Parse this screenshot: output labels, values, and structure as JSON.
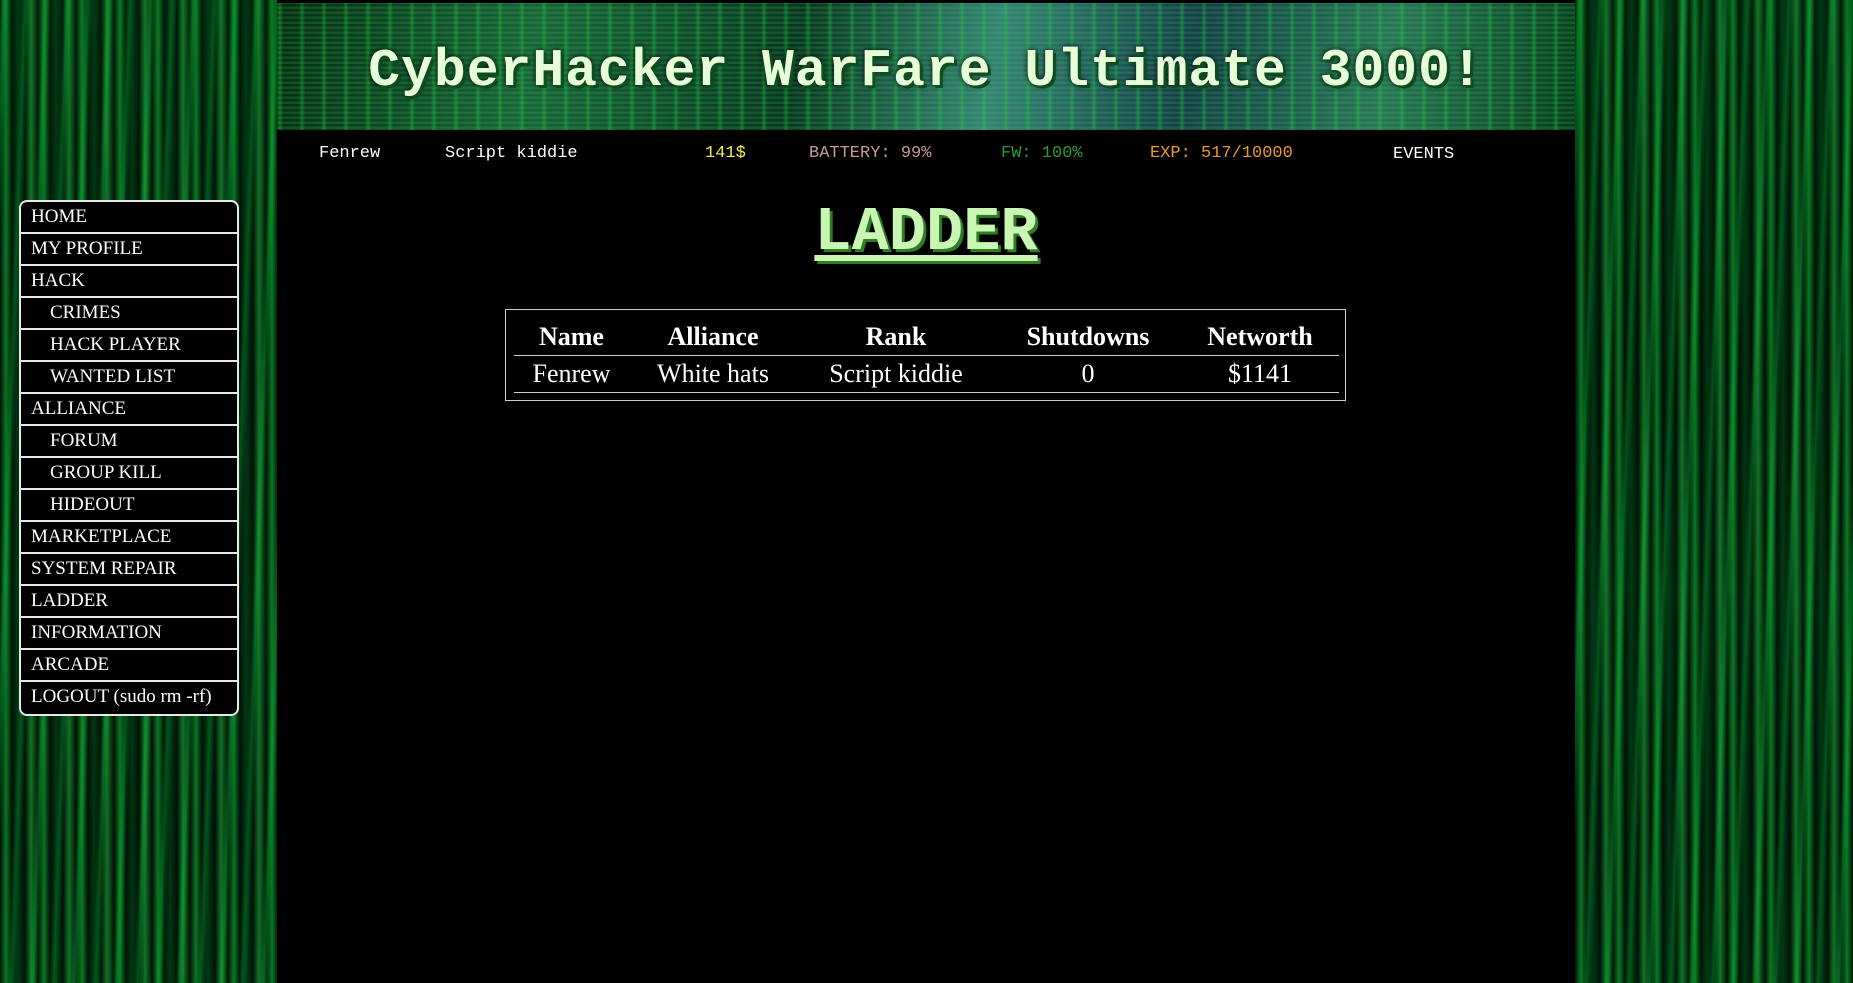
{
  "banner": {
    "title": "CyberHacker WarFare Ultimate 3000!"
  },
  "status": {
    "username": "Fenrew",
    "rank": "Script kiddie",
    "money": "141$",
    "battery": "BATTERY: 99%",
    "firewall": "FW: 100%",
    "exp": "EXP: 517/10000",
    "events": "EVENTS"
  },
  "colors": {
    "money": "#f0f04a",
    "battery": "#c79a9a",
    "firewall": "#2e9a2e",
    "exp": "#e89a2a",
    "title_text": "#c9f7b3"
  },
  "nav": [
    {
      "label": "HOME"
    },
    {
      "label": "MY PROFILE"
    },
    {
      "label": "HACK"
    },
    {
      "label": "CRIMES"
    },
    {
      "label": "HACK PLAYER"
    },
    {
      "label": "WANTED LIST"
    },
    {
      "label": "ALLIANCE"
    },
    {
      "label": "FORUM"
    },
    {
      "label": "GROUP KILL"
    },
    {
      "label": "HIDEOUT"
    },
    {
      "label": "MARKETPLACE"
    },
    {
      "label": "SYSTEM REPAIR"
    },
    {
      "label": "LADDER"
    },
    {
      "label": "INFORMATION"
    },
    {
      "label": "ARCADE"
    },
    {
      "label": "LOGOUT (sudo rm -rf)"
    }
  ],
  "page": {
    "title": "LADDER"
  },
  "ladder": {
    "columns": [
      "Name",
      "Alliance",
      "Rank",
      "Shutdowns",
      "Networth"
    ],
    "rows": [
      {
        "name": "Fenrew",
        "alliance": "White hats",
        "rank": "Script kiddie",
        "shutdowns": "0",
        "networth": "$1141"
      }
    ]
  }
}
